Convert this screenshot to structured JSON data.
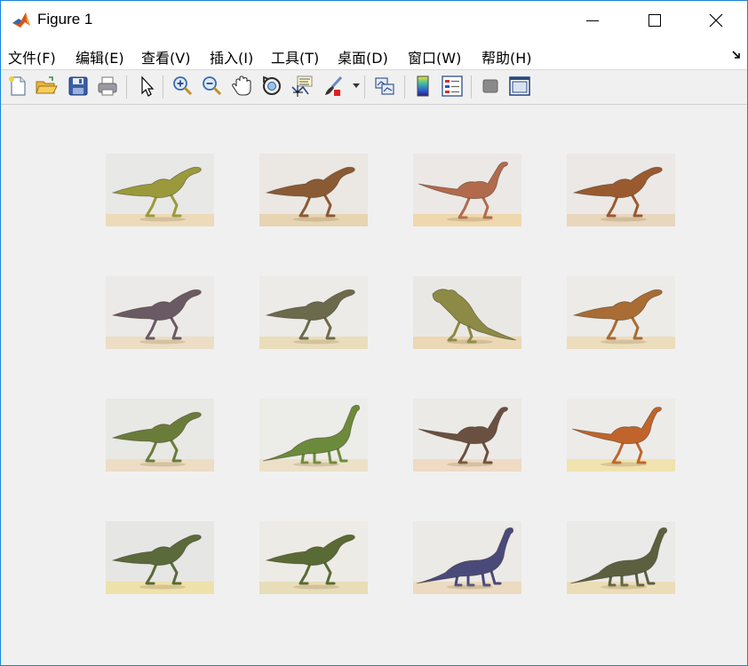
{
  "window": {
    "title": "Figure 1"
  },
  "menu": [
    {
      "label": "文件(F)"
    },
    {
      "label": "编辑(E)"
    },
    {
      "label": "查看(V)"
    },
    {
      "label": "插入(I)"
    },
    {
      "label": "工具(T)"
    },
    {
      "label": "桌面(D)"
    },
    {
      "label": "窗口(W)"
    },
    {
      "label": "帮助(H)"
    }
  ],
  "toolbar_icons": [
    "new-figure-icon",
    "open-file-icon",
    "save-icon",
    "print-icon",
    "edit-plot-icon",
    "zoom-in-icon",
    "zoom-out-icon",
    "pan-icon",
    "rotate-3d-icon",
    "data-cursor-icon",
    "brush-icon",
    "link-plot-icon",
    "colorbar-icon",
    "legend-icon",
    "hide-plot-tools-icon",
    "show-plot-tools-icon"
  ],
  "images": [
    {
      "name": "dinosaur-1",
      "bg": "#e8e8e6",
      "ground": "#ecd8b4",
      "body": "#9a9a3c",
      "shape": "biped"
    },
    {
      "name": "dinosaur-2",
      "bg": "#ebe7e2",
      "ground": "#e6d2ae",
      "body": "#8a5a34",
      "shape": "biped"
    },
    {
      "name": "dinosaur-3",
      "bg": "#ece8e6",
      "ground": "#f0d6a6",
      "body": "#b26a4c",
      "shape": "ostrich"
    },
    {
      "name": "dinosaur-4",
      "bg": "#ebe8e6",
      "ground": "#e8d4b8",
      "body": "#9a5a30",
      "shape": "biped"
    },
    {
      "name": "dinosaur-5",
      "bg": "#ebeae8",
      "ground": "#ecdcc0",
      "body": "#6a5a64",
      "shape": "biped"
    },
    {
      "name": "dinosaur-6",
      "bg": "#ecebe8",
      "ground": "#eadcb6",
      "body": "#6c6a4c",
      "shape": "biped"
    },
    {
      "name": "dinosaur-7",
      "bg": "#eae8e4",
      "ground": "#ecd6ae",
      "body": "#8c8a44",
      "shape": "rearing"
    },
    {
      "name": "dinosaur-8",
      "bg": "#ecebe8",
      "ground": "#ecdcb8",
      "body": "#a86c34",
      "shape": "biped"
    },
    {
      "name": "dinosaur-9",
      "bg": "#e8e8e4",
      "ground": "#ecdcc0",
      "body": "#6a7c3a",
      "shape": "biped"
    },
    {
      "name": "dinosaur-10",
      "bg": "#ecece8",
      "ground": "#ece0c4",
      "body": "#6c8a3c",
      "shape": "sauropod"
    },
    {
      "name": "dinosaur-11",
      "bg": "#eceae6",
      "ground": "#f0d8c0",
      "body": "#6a5040",
      "shape": "ostrich"
    },
    {
      "name": "dinosaur-12",
      "bg": "#ecebe8",
      "ground": "#f2e2a8",
      "body": "#c0642c",
      "shape": "ostrich"
    },
    {
      "name": "dinosaur-13",
      "bg": "#e6e6e4",
      "ground": "#f0e0a4",
      "body": "#5a6a3a",
      "shape": "biped"
    },
    {
      "name": "dinosaur-14",
      "bg": "#ecebe6",
      "ground": "#e8dcb4",
      "body": "#5a6a34",
      "shape": "biped"
    },
    {
      "name": "dinosaur-15",
      "bg": "#eceae6",
      "ground": "#ecd8bc",
      "body": "#4a4a7a",
      "shape": "sauropod"
    },
    {
      "name": "dinosaur-16",
      "bg": "#eaeae8",
      "ground": "#ecdcb4",
      "body": "#5c6040",
      "shape": "sauropod"
    }
  ]
}
